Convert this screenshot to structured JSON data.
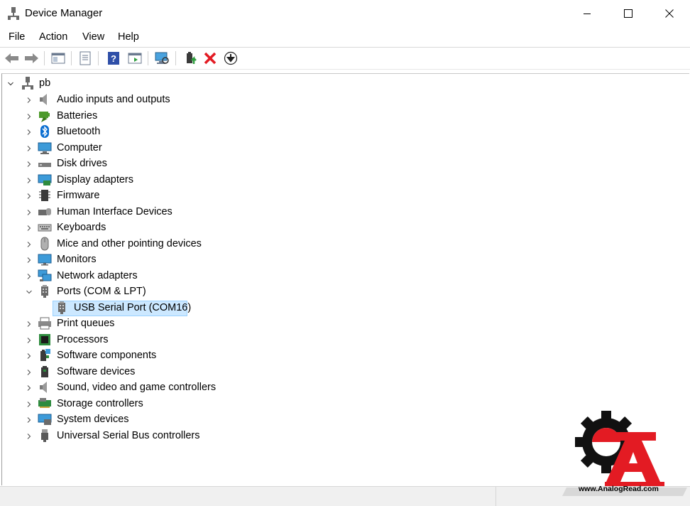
{
  "window": {
    "title": "Device Manager"
  },
  "menu": {
    "items": [
      "File",
      "Action",
      "View",
      "Help"
    ]
  },
  "toolbar": {
    "buttons": [
      "back-icon",
      "forward-icon",
      "show-hide-console-tree-icon",
      "properties-icon",
      "help-icon",
      "action-pane-icon",
      "scan-hardware-icon",
      "update-driver-icon",
      "uninstall-icon",
      "disable-icon"
    ]
  },
  "tree": {
    "root": "pb",
    "categories": [
      {
        "label": "Audio inputs and outputs",
        "icon": "speaker-icon",
        "expanded": false
      },
      {
        "label": "Batteries",
        "icon": "battery-icon",
        "expanded": false
      },
      {
        "label": "Bluetooth",
        "icon": "bluetooth-icon",
        "expanded": false
      },
      {
        "label": "Computer",
        "icon": "computer-icon",
        "expanded": false
      },
      {
        "label": "Disk drives",
        "icon": "disk-drive-icon",
        "expanded": false
      },
      {
        "label": "Display adapters",
        "icon": "display-adapter-icon",
        "expanded": false
      },
      {
        "label": "Firmware",
        "icon": "firmware-icon",
        "expanded": false
      },
      {
        "label": "Human Interface Devices",
        "icon": "hid-icon",
        "expanded": false
      },
      {
        "label": "Keyboards",
        "icon": "keyboard-icon",
        "expanded": false
      },
      {
        "label": "Mice and other pointing devices",
        "icon": "mouse-icon",
        "expanded": false
      },
      {
        "label": "Monitors",
        "icon": "monitor-icon",
        "expanded": false
      },
      {
        "label": "Network adapters",
        "icon": "network-adapter-icon",
        "expanded": false
      },
      {
        "label": "Ports (COM & LPT)",
        "icon": "port-icon",
        "expanded": true,
        "children": [
          {
            "label": "USB Serial Port (COM16)",
            "icon": "port-icon",
            "selected": true
          }
        ]
      },
      {
        "label": "Print queues",
        "icon": "printer-icon",
        "expanded": false
      },
      {
        "label": "Processors",
        "icon": "processor-icon",
        "expanded": false
      },
      {
        "label": "Software components",
        "icon": "software-component-icon",
        "expanded": false
      },
      {
        "label": "Software devices",
        "icon": "software-device-icon",
        "expanded": false
      },
      {
        "label": "Sound, video and game controllers",
        "icon": "sound-icon",
        "expanded": false
      },
      {
        "label": "Storage controllers",
        "icon": "storage-controller-icon",
        "expanded": false
      },
      {
        "label": "System devices",
        "icon": "system-device-icon",
        "expanded": false
      },
      {
        "label": "Universal Serial Bus controllers",
        "icon": "usb-icon",
        "expanded": false
      }
    ]
  },
  "watermark": {
    "text": "www.AnalogRead.com"
  },
  "colors": {
    "selection": "#cce8ff",
    "selection_border": "#99d1ff",
    "accent_red": "#e31b23"
  }
}
